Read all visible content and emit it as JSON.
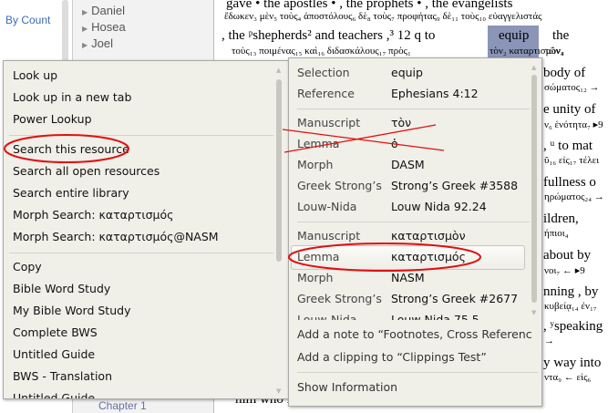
{
  "sidebar": {
    "by_count": "By Count"
  },
  "tree": {
    "items": [
      "Daniel",
      "Hosea",
      "Joel"
    ],
    "chapter": "Chapter 1"
  },
  "bible": {
    "line1_en": "gave  •  the   apostles  • , the prophets • ,  the   evangelists",
    "line1_gr": "ἔδωκεν₃ μὲν₅ τοὺς₄  ἀποστόλους₆ δὲ₈  τοὺς₇ προφήτας₉ δὲ₁₁  τοὺς₁₀  εὐαγγελιστάς",
    "line2_en": ", the ᵖshepherds² and  teachers  ,³ 12 q  to",
    "line2_gr": "τοὺς₁₃  ποιμένας₁₅  καὶ₁₆ διδασκάλους₁₇       πρὸς₁",
    "selected_en": "equip",
    "selected_gr": "τὸν₂ καταρτισμὸν₃",
    "after_en": "the",
    "after_gr": "τῶν₄",
    "right_lines": [
      {
        "en": "body  of",
        "gr": "σώματος₁₂ →"
      },
      {
        "en": "e  unity  of",
        "gr": "ν₆ ἑνότητα₇ ▸9"
      },
      {
        "en": ", ᵘ to  mat",
        "gr": "ῦ₁₆  εἰς₁₇ τέλει"
      },
      {
        "en": "fullness   o",
        "gr": "ηρώματος₂₄ →"
      },
      {
        "en": "ildren,",
        "gr": "ήπιοι₄"
      },
      {
        "en": "about by",
        "gr": "νοι₇   ←    ▸9"
      },
      {
        "en": "nning , by",
        "gr": "κυβείᾳ₁₄  ἐν₁₇"
      },
      {
        "en": ", ʸspeaking",
        "gr": "  →"
      },
      {
        "en": "y   way into",
        "gr": "ντα₉  ←   εἰς₆"
      },
      {
        "en": "him who is the head , into Christ ,  from whom the wh",
        "gr": ""
      }
    ]
  },
  "context_menu": {
    "group1": [
      "Look up",
      "Look up in a new tab",
      "Power Lookup"
    ],
    "group2": [
      "Search this resource",
      "Search all open resources",
      "Search entire library",
      "Morph Search: καταρτισμός",
      "Morph Search: καταρτισμός@NASM"
    ],
    "group3": [
      "Copy",
      "Bible Word Study",
      "My Bible Word Study",
      "Complete BWS",
      "Untitled Guide",
      "BWS - Translation",
      "Untitled Guide"
    ]
  },
  "info_panel": {
    "rows1": [
      {
        "label": "Selection",
        "value": "equip"
      },
      {
        "label": "Reference",
        "value": "Ephesians 4:12"
      }
    ],
    "rows2": [
      {
        "label": "Manuscript",
        "value": "τὸν"
      },
      {
        "label": "Lemma",
        "value": "ὁ"
      },
      {
        "label": "Morph",
        "value": "DASM"
      },
      {
        "label": "Greek Strong’s",
        "value": "Strong’s Greek #3588"
      },
      {
        "label": "Louw-Nida",
        "value": "Louw Nida 92.24"
      }
    ],
    "rows3": [
      {
        "label": "Manuscript",
        "value": "καταρτισμὸν"
      },
      {
        "label": "Lemma",
        "value": "καταρτισμός"
      },
      {
        "label": "Morph",
        "value": "NASM"
      },
      {
        "label": "Greek Strong’s",
        "value": "Strong’s Greek #2677"
      },
      {
        "label": "Louw-Nida",
        "value": "Louw Nida 75.5"
      }
    ],
    "add_note": "Add a note to “Footnotes, Cross References & B",
    "add_clipping": "Add a clipping to “Clippings Test”",
    "show_info": "Show Information"
  },
  "colors": {
    "annotation": "#e01010",
    "selection_highlight": "#8a95b8",
    "link": "#3a6eb5",
    "menu_bg": "#f0efe8"
  }
}
